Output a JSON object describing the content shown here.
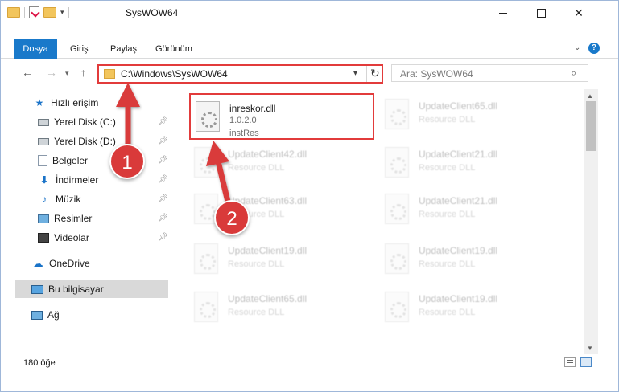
{
  "window": {
    "title": "SysWOW64"
  },
  "ribbon": {
    "tabs": [
      "Dosya",
      "Giriş",
      "Paylaş",
      "Görünüm"
    ],
    "help_label": "?"
  },
  "address": {
    "path": "C:\\Windows\\SysWOW64",
    "search_placeholder": "Ara: SysWOW64"
  },
  "sidebar": {
    "items": [
      {
        "label": "Hızlı erişim",
        "icon": "star-icon"
      },
      {
        "label": "Yerel Disk (C:)",
        "icon": "drive-icon"
      },
      {
        "label": "Yerel Disk (D:)",
        "icon": "drive-icon"
      },
      {
        "label": "Belgeler",
        "icon": "documents-icon"
      },
      {
        "label": "İndirmeler",
        "icon": "download-icon"
      },
      {
        "label": "Müzik",
        "icon": "music-icon"
      },
      {
        "label": "Resimler",
        "icon": "pictures-icon"
      },
      {
        "label": "Videolar",
        "icon": "videos-icon"
      },
      {
        "label": "OneDrive",
        "icon": "cloud-icon"
      },
      {
        "label": "Bu bilgisayar",
        "icon": "computer-icon"
      },
      {
        "label": "Ağ",
        "icon": "network-icon"
      }
    ]
  },
  "files": {
    "highlighted": {
      "name": "inreskor.dll",
      "version": "1.0.2.0",
      "description": "instRes"
    },
    "items": [
      {
        "name": "UpdateClient65.dll",
        "desc": "Resource DLL"
      },
      {
        "name": "UpdateClient42.dll",
        "desc": "Resource DLL"
      },
      {
        "name": "UpdateClient21.dll",
        "desc": "Resource DLL"
      },
      {
        "name": "UpdateClient63.dll",
        "desc": "Resource DLL"
      },
      {
        "name": "UpdateClient21.dll",
        "desc": "Resource DLL"
      },
      {
        "name": "UpdateClient19.dll",
        "desc": "Resource DLL"
      },
      {
        "name": "UpdateClient19.dll",
        "desc": "Resource DLL"
      },
      {
        "name": "UpdateClient65.dll",
        "desc": "Resource DLL"
      },
      {
        "name": "UpdateClient19.dll",
        "desc": "Resource DLL"
      }
    ]
  },
  "status": {
    "count": "180 öğe"
  },
  "annotations": {
    "step1": "1",
    "step2": "2",
    "color": "#d93a3a"
  }
}
